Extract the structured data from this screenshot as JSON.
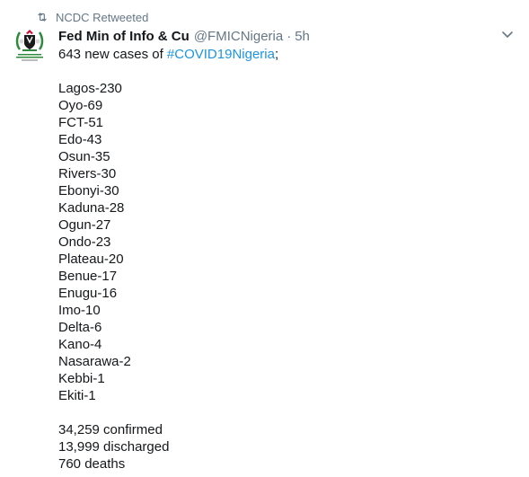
{
  "retweet": {
    "label": "NCDC Retweeted",
    "icon": "retweet-icon"
  },
  "author": {
    "name": "Fed Min of Info & Cu",
    "handle": "@FMICNigeria",
    "separator": "·",
    "time": "5h",
    "avatar_icon": "ministry-logo-avatar",
    "avatar_logo_text": [
      "FEDERAL MINISTRY OF",
      "INFORMATION AND CULTURE",
      "www.fmic.gov.ng"
    ]
  },
  "menu_icon": "chevron-down-icon",
  "tweet": {
    "intro_prefix": "643 new cases of ",
    "hashtag": "#COVID19Nigeria",
    "intro_suffix": ";",
    "states": [
      "Lagos-230",
      "Oyo-69",
      "FCT-51",
      "Edo-43",
      "Osun-35",
      "Rivers-30",
      "Ebonyi-30",
      "Kaduna-28",
      "Ogun-27",
      "Ondo-23",
      "Plateau-20",
      "Benue-17",
      "Enugu-16",
      "Imo-10",
      "Delta-6",
      "Kano-4",
      "Nasarawa-2",
      "Kebbi-1",
      "Ekiti-1"
    ],
    "totals": [
      "34,259 confirmed",
      "13,999 discharged",
      "760 deaths"
    ]
  },
  "colors": {
    "text": "#14171a",
    "secondary": "#657786",
    "link": "#1b95e0"
  }
}
